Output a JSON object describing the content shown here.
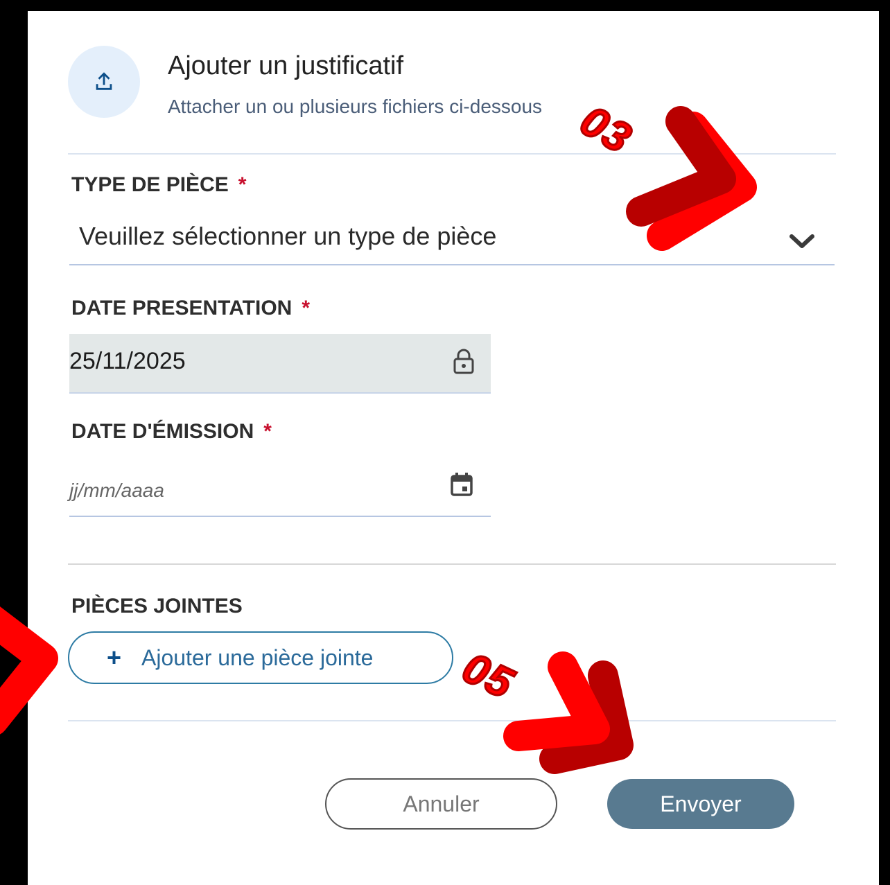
{
  "header": {
    "icon": "upload-icon",
    "title": "Ajouter un justificatif",
    "subtitle": "Attacher un ou plusieurs fichiers ci-dessous"
  },
  "piece_type": {
    "label": "TYPE DE PIÈCE",
    "required_mark": "*",
    "value": "Veuillez sélectionner un type de pièce",
    "icon": "chevron-down-icon"
  },
  "date_presentation": {
    "label": "DATE PRESENTATION",
    "required_mark": "*",
    "value": "25/11/2025",
    "icon": "lock-icon"
  },
  "date_emission": {
    "label": "DATE D'ÉMISSION",
    "required_mark": "*",
    "placeholder": "jj/mm/aaaa",
    "icon": "calendar-icon"
  },
  "attachments": {
    "label": "PIÈCES JOINTES",
    "add_icon": "+",
    "add_label": "Ajouter une pièce jointe"
  },
  "actions": {
    "cancel_label": "Annuler",
    "send_label": "Envoyer"
  },
  "annotations": {
    "step_a": "03",
    "step_b": "05",
    "color": "#ff0000"
  }
}
